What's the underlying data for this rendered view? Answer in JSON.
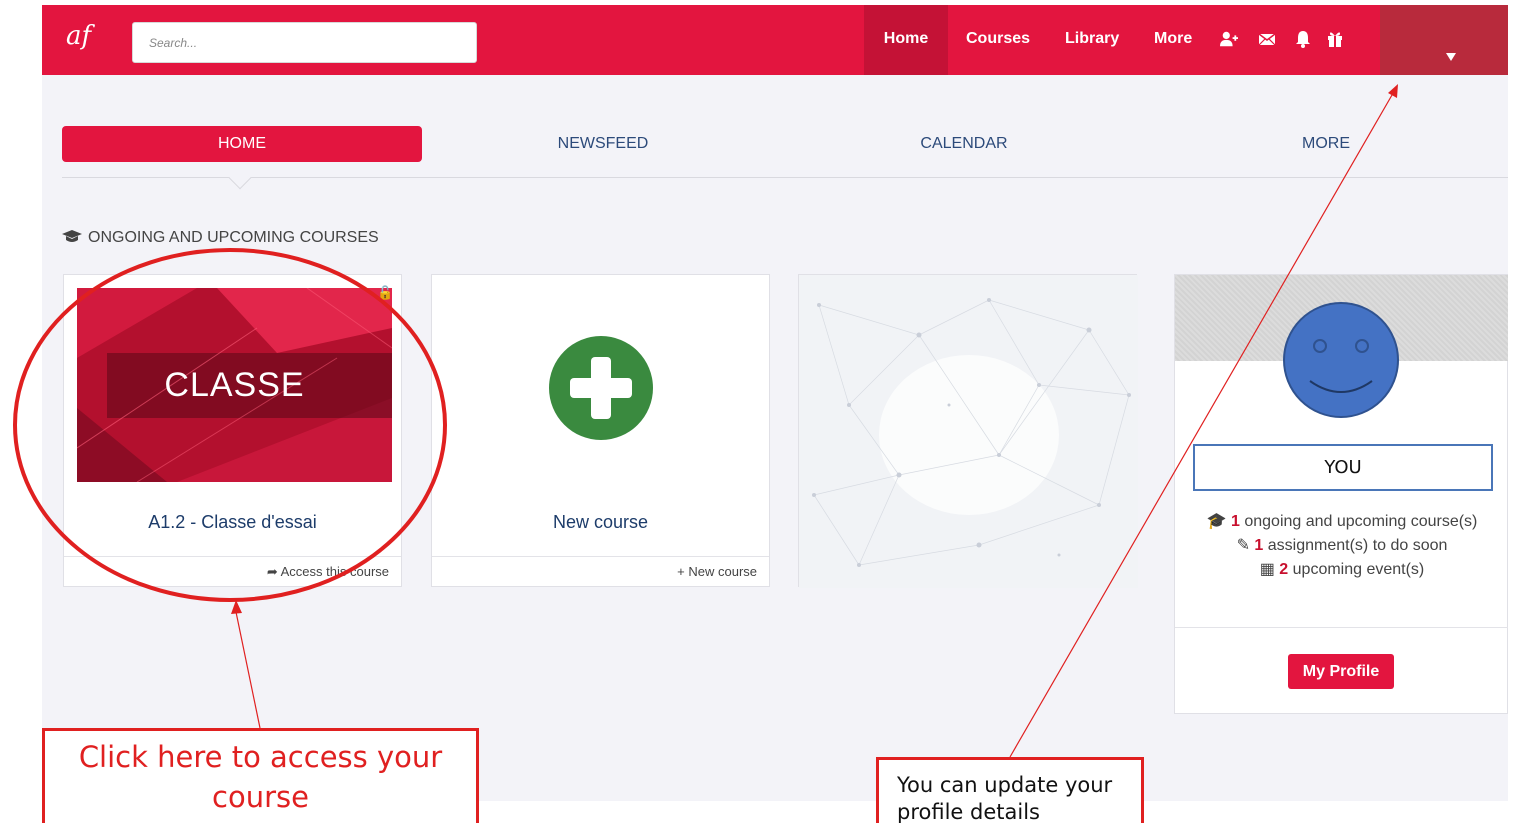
{
  "topbar": {
    "logo": "af",
    "search_placeholder": "Search...",
    "nav": {
      "home": "Home",
      "courses": "Courses",
      "library": "Library",
      "more": "More"
    },
    "icons": [
      "add-user-icon",
      "envelope-icon",
      "bell-icon",
      "gift-icon"
    ],
    "colors": {
      "bar": "#e3153f",
      "active": "#c41236",
      "profile": "#b82a3c"
    }
  },
  "tabs": {
    "home": "HOME",
    "newsfeed": "NEWSFEED",
    "calendar": "CALENDAR",
    "more": "MORE"
  },
  "section": {
    "title": "ONGOING AND UPCOMING COURSES",
    "icon": "graduation-cap-icon"
  },
  "course_card": {
    "image_label": "CLASSE",
    "title": "A1.2 - Classe d'essai",
    "footer_link": "Access this course"
  },
  "new_course_card": {
    "title": "New course",
    "footer_link": "New course",
    "accent": "#3a8a3f"
  },
  "profile_card": {
    "name": "YOU",
    "stats": {
      "courses_count": "1",
      "courses_text": "ongoing and upcoming course(s)",
      "assignments_count": "1",
      "assignments_text": "assignment(s) to do soon",
      "events_count": "2",
      "events_text": "upcoming event(s)"
    },
    "button": "My Profile"
  },
  "annotations": {
    "left": "Click here to access your course",
    "right": "You can update your profile details"
  }
}
